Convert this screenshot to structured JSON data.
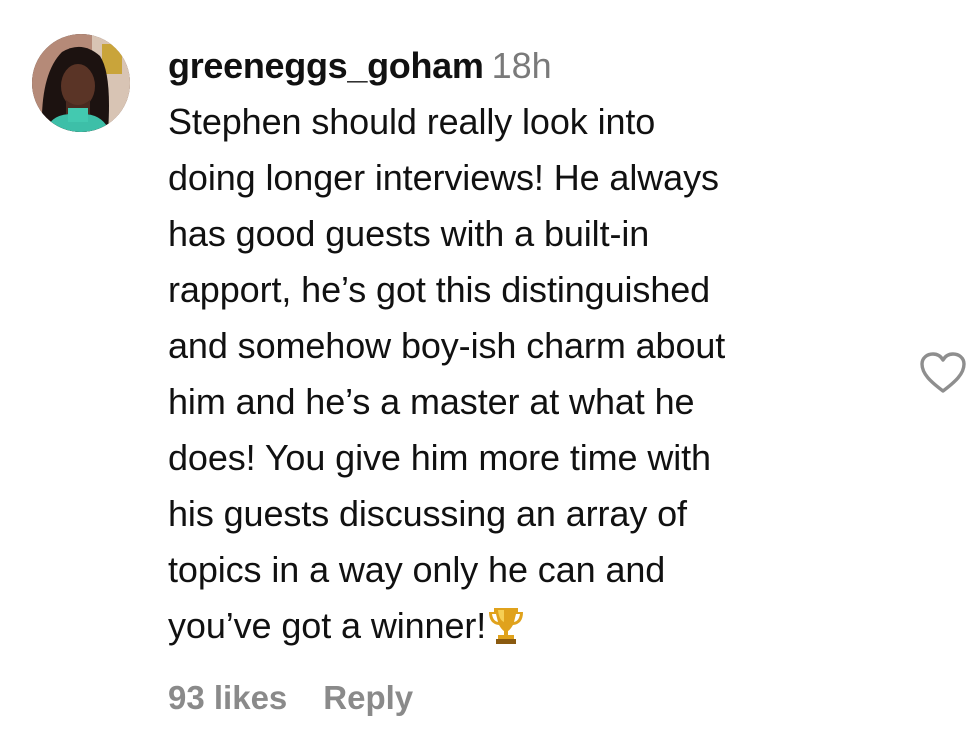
{
  "comment": {
    "username": "greeneggs_goham",
    "timestamp": "18h",
    "text_lines": [
      "Stephen should really look into",
      "doing longer interviews! He always",
      "has good guests with a built-in",
      "rapport, he’s got this distinguished",
      "and somehow boy-ish charm about",
      "him and he’s a master at what he",
      "does! You give him more time with",
      "his guests discussing an array of",
      "topics in a way only he can and",
      "you’ve got a winner!"
    ],
    "emoji": "trophy-icon",
    "likes_label": "93 likes",
    "reply_label": "Reply"
  },
  "colors": {
    "text": "#111111",
    "muted": "#7a7a7a",
    "action": "#8a8a8a",
    "heart_stroke": "#8e8e8e"
  }
}
